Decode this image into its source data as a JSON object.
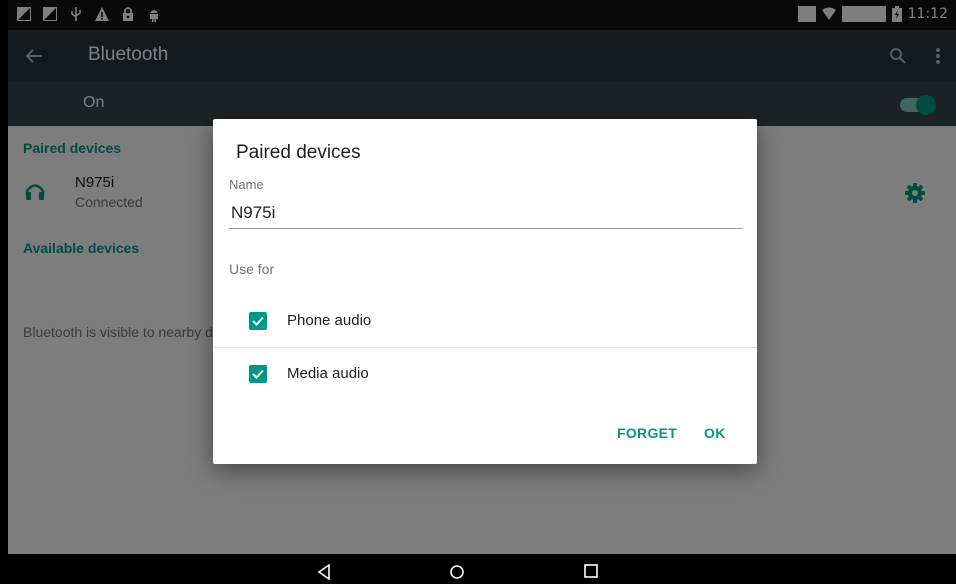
{
  "status_bar": {
    "time": "11:12",
    "notification_icons": [
      "image-icon",
      "image-icon",
      "usb-icon",
      "warning-icon",
      "lock-icon",
      "android-icon"
    ],
    "right_icons": [
      "sim-icon",
      "wifi-icon",
      "battery-charging-icon"
    ]
  },
  "appbar": {
    "title": "Bluetooth",
    "background": "#263238"
  },
  "toggle": {
    "label": "On",
    "on": true,
    "background": "#37474f"
  },
  "content": {
    "paired_header": "Paired devices",
    "device": {
      "name": "N975i",
      "status": "Connected",
      "icon": "headset-icon"
    },
    "available_header": "Available devices",
    "visibility_text": "Bluetooth is visible to nearby devices while Bluetooth settings is open."
  },
  "dialog": {
    "title": "Paired devices",
    "name_label": "Name",
    "name_value": "N975i",
    "use_for_label": "Use for",
    "options": [
      {
        "label": "Phone audio",
        "checked": true
      },
      {
        "label": "Media audio",
        "checked": true
      }
    ],
    "forget_label": "FORGET",
    "ok_label": "OK"
  },
  "colors": {
    "accent": "#009688",
    "scrim": "rgba(0,0,0,0.5)"
  },
  "navbar": {
    "buttons": [
      "back-icon",
      "home-icon",
      "recents-icon"
    ]
  }
}
